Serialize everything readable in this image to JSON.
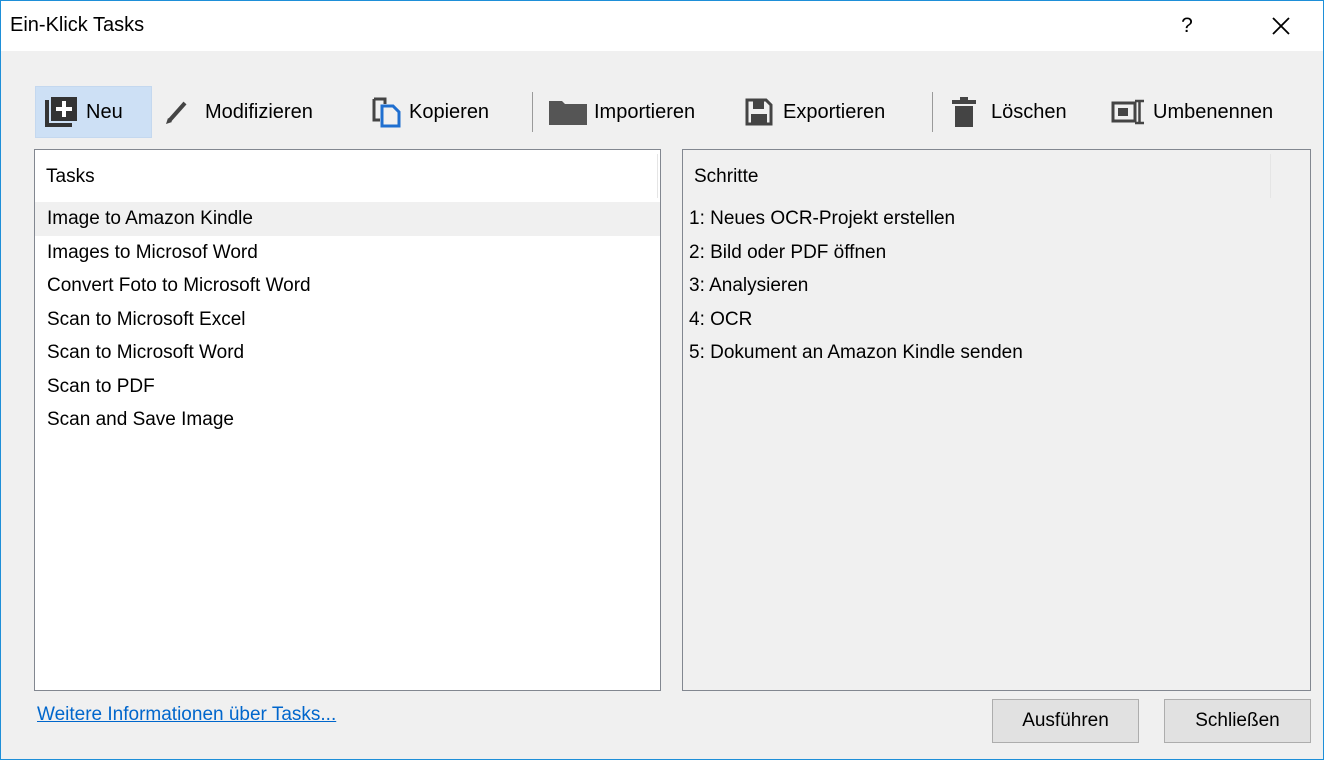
{
  "window": {
    "title": "Ein-Klick Tasks",
    "help_label": "?",
    "close_icon": "close-icon"
  },
  "toolbar": {
    "items": [
      {
        "label": "Neu",
        "icon": "new-plus-icon",
        "selected": true
      },
      {
        "label": "Modifizieren",
        "icon": "pencil-icon"
      },
      {
        "label": "Kopieren",
        "icon": "copy-icon"
      },
      {
        "label": "Importieren",
        "icon": "folder-icon"
      },
      {
        "label": "Exportieren",
        "icon": "save-icon"
      },
      {
        "label": "Löschen",
        "icon": "trash-icon"
      },
      {
        "label": "Umbenennen",
        "icon": "rename-icon"
      }
    ]
  },
  "tasks": {
    "header": "Tasks",
    "items": [
      "Image to Amazon Kindle",
      "Images to Microsof Word",
      "Convert Foto to Microsoft Word",
      "Scan to Microsoft Excel",
      "Scan to Microsoft Word",
      "Scan to PDF",
      "Scan and Save Image"
    ],
    "selected_index": 0
  },
  "steps": {
    "header": "Schritte",
    "items": [
      "1: Neues OCR-Projekt erstellen",
      "2: Bild oder PDF öffnen",
      "3: Analysieren",
      "4: OCR",
      "5: Dokument an Amazon Kindle senden"
    ]
  },
  "footer": {
    "info_link": "Weitere Informationen über Tasks...",
    "run_label": "Ausführen",
    "close_label": "Schließen"
  },
  "colors": {
    "accent_border": "#1e8fd8",
    "selected_toolbar_bg": "#cde0f5",
    "icon_dark": "#444444",
    "icon_blue": "#1f6fd0",
    "link": "#0066cc"
  }
}
